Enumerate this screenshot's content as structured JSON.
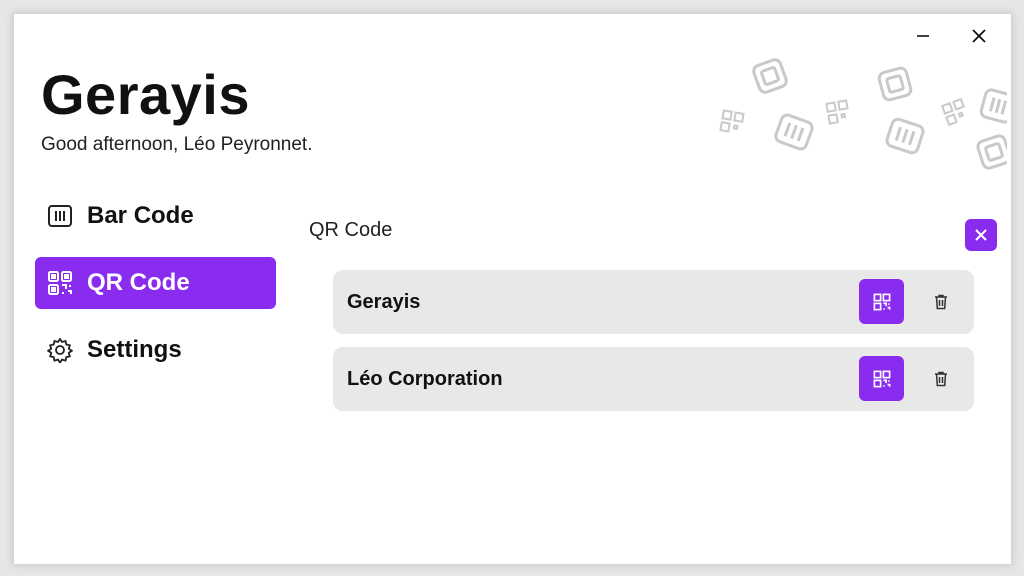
{
  "app": {
    "title": "Gerayis",
    "greeting": "Good afternoon, Léo Peyronnet."
  },
  "window_controls": {
    "minimize_icon": "minimize-icon",
    "close_icon": "close-icon"
  },
  "sidebar": {
    "items": [
      {
        "label": "Bar Code",
        "icon": "barcode-icon",
        "active": false
      },
      {
        "label": "QR Code",
        "icon": "qr-code-icon",
        "active": true
      },
      {
        "label": "Settings",
        "icon": "gear-icon",
        "active": false
      }
    ]
  },
  "main": {
    "section_title": "QR Code",
    "saved_items": [
      {
        "name": "Gerayis"
      },
      {
        "name": "Léo Corporation"
      }
    ]
  },
  "colors": {
    "accent": "#8a2cf0",
    "item_bg": "#e8e8e8",
    "text": "#111111"
  }
}
